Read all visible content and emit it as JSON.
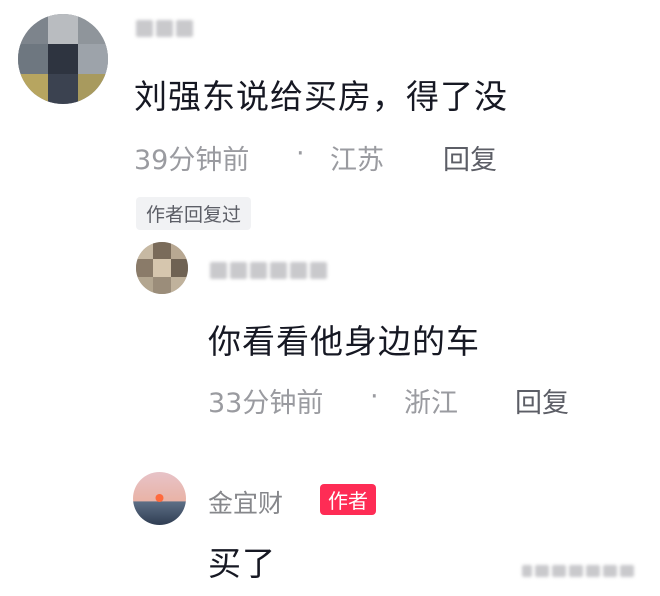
{
  "comment": {
    "text": "刘强东说给买房，得了没",
    "time": "39分钟前",
    "separator": "·",
    "location": "江苏",
    "reply_label": "回复",
    "author_replied_chip": "作者回复过"
  },
  "reply1": {
    "text": "你看看他身边的车",
    "time": "33分钟前",
    "separator": "·",
    "location": "浙江",
    "reply_label": "回复"
  },
  "reply2": {
    "username": "金宜财",
    "badge": "作者",
    "text": "买了"
  },
  "colors": {
    "badge": "#fe2c55",
    "meta": "#9a9ba0",
    "text": "#161823"
  }
}
